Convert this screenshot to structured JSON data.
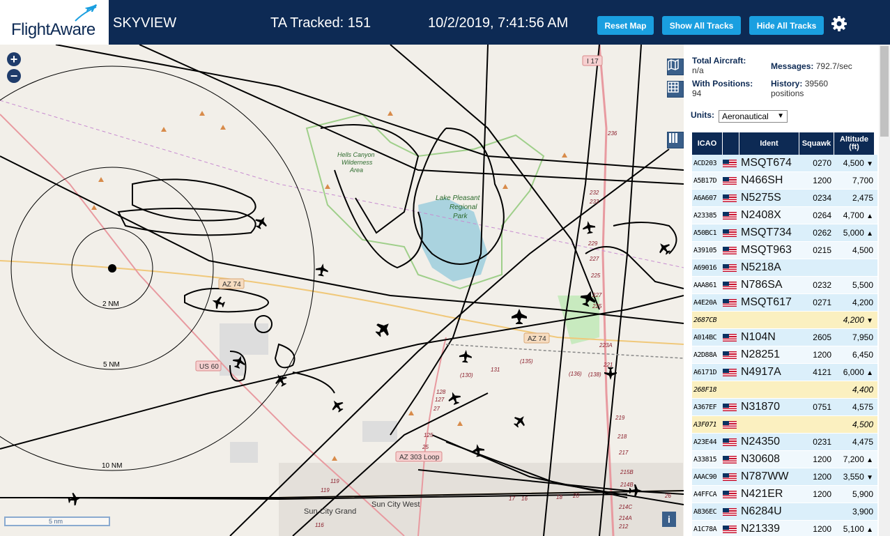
{
  "header": {
    "logo_text": "FlightAware",
    "site_name": "SKYVIEW",
    "ta_tracked": "TA Tracked: 151",
    "datetime": "10/2/2019, 7:41:56 AM",
    "buttons": {
      "reset": "Reset Map",
      "show": "Show All Tracks",
      "hide": "Hide All Tracks"
    },
    "settings_icon": "gear-icon"
  },
  "map": {
    "rings": [
      "2 NM",
      "5 NM",
      "10 NM"
    ],
    "labels": {
      "wilderness": [
        "Hells Canyon",
        "Wilderness",
        "Area"
      ],
      "lake": [
        "Lake Pleasant",
        "Regional",
        "Park"
      ],
      "az74_a": "AZ 74",
      "az74_b": "AZ 74",
      "us60": "US 60",
      "az303": "AZ 303 Loop",
      "i17": "I 17",
      "sun_city_west": "Sun City West",
      "sun_city_grand": "Sun City Grand",
      "scale": "5 nm"
    },
    "exit_numbers": [
      "236",
      "232",
      "233",
      "229",
      "227",
      "225",
      "223A",
      "221",
      "219",
      "218",
      "217",
      "215B",
      "214B",
      "214C",
      "214A",
      "212",
      "131",
      "(135)",
      "(130)",
      "(136)",
      "(138)",
      "128",
      "127",
      "27",
      "125",
      "25",
      "119",
      "119",
      "116",
      "17",
      "16",
      "18",
      "20",
      "26",
      "227",
      "225"
    ]
  },
  "sidebar": {
    "total_aircraft_label": "Total Aircraft:",
    "total_aircraft_value": "n/a",
    "with_positions_label": "With Positions:",
    "with_positions_value": "94",
    "messages_label": "Messages:",
    "messages_value": "792.7/sec",
    "history_label": "History:",
    "history_value": "39560",
    "history_unit": "positions",
    "units_label": "Units:",
    "units_value": "Aeronautical"
  },
  "table": {
    "headers": [
      "ICAO",
      "",
      "Ident",
      "Squawk",
      "Altitude (ft)"
    ],
    "rows": [
      {
        "icao": "ACD203",
        "flag": true,
        "ident": "MSQT674",
        "squawk": "0270",
        "alt": "4,500",
        "trend": "▼",
        "hl": false
      },
      {
        "icao": "A5B17D",
        "flag": true,
        "ident": "N466SH",
        "squawk": "1200",
        "alt": "7,700",
        "trend": "",
        "hl": false
      },
      {
        "icao": "A6A607",
        "flag": true,
        "ident": "N5275S",
        "squawk": "0234",
        "alt": "2,475",
        "trend": "",
        "hl": false
      },
      {
        "icao": "A23385",
        "flag": true,
        "ident": "N2408X",
        "squawk": "0264",
        "alt": "4,700",
        "trend": "▲",
        "hl": false
      },
      {
        "icao": "A50BC1",
        "flag": true,
        "ident": "MSQT734",
        "squawk": "0262",
        "alt": "5,000",
        "trend": "▲",
        "hl": false
      },
      {
        "icao": "A39105",
        "flag": true,
        "ident": "MSQT963",
        "squawk": "0215",
        "alt": "4,500",
        "trend": "",
        "hl": false
      },
      {
        "icao": "A69016",
        "flag": true,
        "ident": "N5218A",
        "squawk": "",
        "alt": "",
        "trend": "",
        "hl": false
      },
      {
        "icao": "AAA861",
        "flag": true,
        "ident": "N786SA",
        "squawk": "0232",
        "alt": "5,500",
        "trend": "",
        "hl": false
      },
      {
        "icao": "A4E20A",
        "flag": true,
        "ident": "MSQT617",
        "squawk": "0271",
        "alt": "4,200",
        "trend": "",
        "hl": false
      },
      {
        "icao": "2687CB",
        "flag": false,
        "ident": "",
        "squawk": "",
        "alt": "4,200",
        "trend": "▼",
        "hl": true
      },
      {
        "icao": "A014BC",
        "flag": true,
        "ident": "N104N",
        "squawk": "2605",
        "alt": "7,950",
        "trend": "",
        "hl": false
      },
      {
        "icao": "A2D88A",
        "flag": true,
        "ident": "N28251",
        "squawk": "1200",
        "alt": "6,450",
        "trend": "",
        "hl": false
      },
      {
        "icao": "A6171D",
        "flag": true,
        "ident": "N4917A",
        "squawk": "4121",
        "alt": "6,000",
        "trend": "▲",
        "hl": false
      },
      {
        "icao": "268F18",
        "flag": false,
        "ident": "",
        "squawk": "",
        "alt": "4,400",
        "trend": "",
        "hl": true
      },
      {
        "icao": "A367EF",
        "flag": true,
        "ident": "N31870",
        "squawk": "0751",
        "alt": "4,575",
        "trend": "",
        "hl": false
      },
      {
        "icao": "A3F071",
        "flag": true,
        "ident": "",
        "squawk": "",
        "alt": "4,500",
        "trend": "",
        "hl": true
      },
      {
        "icao": "A23E44",
        "flag": true,
        "ident": "N24350",
        "squawk": "0231",
        "alt": "4,475",
        "trend": "",
        "hl": false
      },
      {
        "icao": "A33815",
        "flag": true,
        "ident": "N30608",
        "squawk": "1200",
        "alt": "7,200",
        "trend": "▲",
        "hl": false
      },
      {
        "icao": "AAAC90",
        "flag": true,
        "ident": "N787WW",
        "squawk": "1200",
        "alt": "3,550",
        "trend": "▼",
        "hl": false
      },
      {
        "icao": "A4FFCA",
        "flag": true,
        "ident": "N421ER",
        "squawk": "1200",
        "alt": "5,900",
        "trend": "",
        "hl": false
      },
      {
        "icao": "A836EC",
        "flag": true,
        "ident": "N6284U",
        "squawk": "",
        "alt": "3,900",
        "trend": "",
        "hl": false
      },
      {
        "icao": "A1C78A",
        "flag": true,
        "ident": "N21339",
        "squawk": "1200",
        "alt": "5,100",
        "trend": "▲",
        "hl": false
      }
    ]
  }
}
